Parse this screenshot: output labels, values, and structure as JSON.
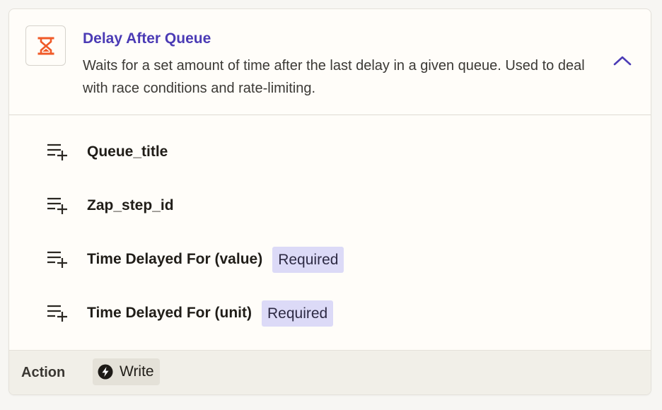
{
  "app": {
    "icon": "hourglass-icon",
    "icon_color": "#f05a28",
    "accent_color": "#4b3bb5"
  },
  "header": {
    "title": "Delay After Queue",
    "description": "Waits for a set amount of time after the last delay in a given queue. Used to deal with race conditions and rate-limiting.",
    "toggle_icon": "chevron-up-icon"
  },
  "fields": [
    {
      "label": "Queue_title",
      "badge": null,
      "icon": "list-add-icon"
    },
    {
      "label": "Zap_step_id",
      "badge": null,
      "icon": "list-add-icon"
    },
    {
      "label": "Time Delayed For (value)",
      "badge": "Required",
      "icon": "list-add-icon"
    },
    {
      "label": "Time Delayed For (unit)",
      "badge": "Required",
      "icon": "list-add-icon"
    }
  ],
  "footer": {
    "label": "Action",
    "chip_label": "Write",
    "chip_icon": "lightning-bolt-icon"
  }
}
